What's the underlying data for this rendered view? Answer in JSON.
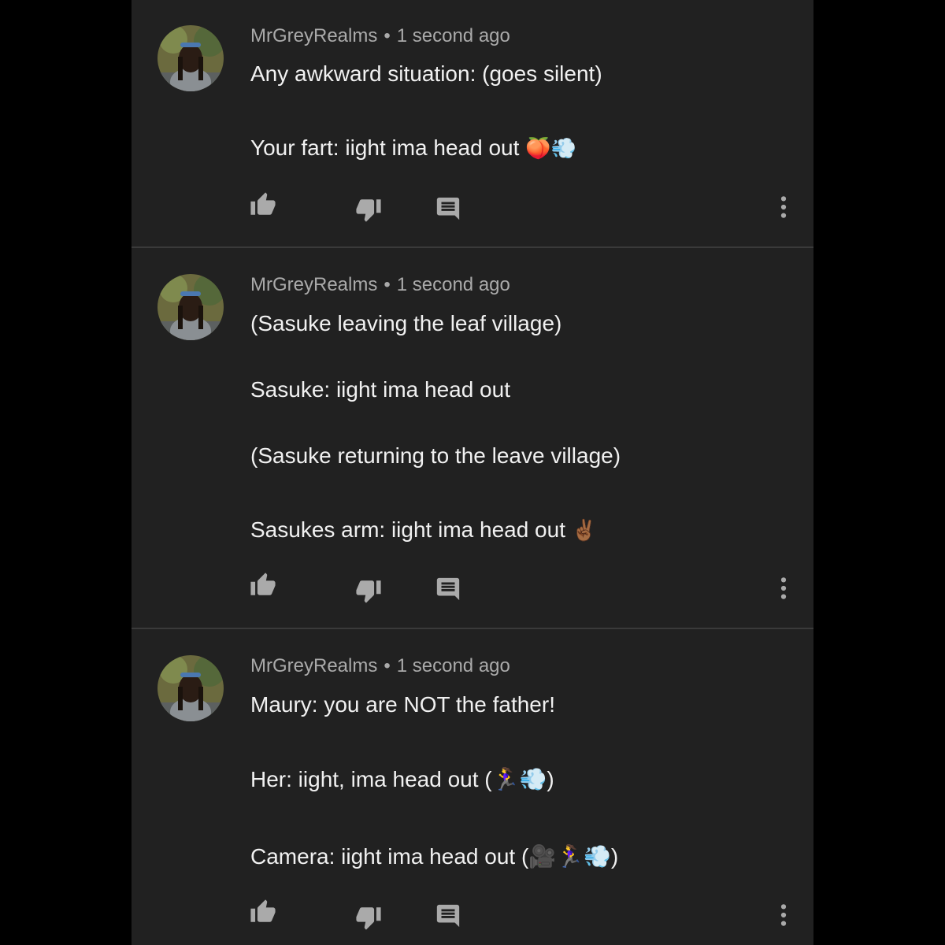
{
  "comments": [
    {
      "author": "MrGreyRealms",
      "separator": "•",
      "time": "1 second ago",
      "lines": [
        {
          "text": "Any awkward situation: (goes silent)",
          "emoji": ""
        },
        {
          "text": "Your fart: iight ima head out ",
          "emoji": "🍑💨"
        }
      ]
    },
    {
      "author": "MrGreyRealms",
      "separator": "•",
      "time": "1 second ago",
      "lines": [
        {
          "text": "(Sasuke leaving the leaf village)",
          "emoji": ""
        },
        {
          "text": "Sasuke: iight ima head out",
          "emoji": ""
        },
        {
          "text": "(Sasuke returning to the leave village)",
          "emoji": ""
        },
        {
          "text": "Sasukes arm: iight ima head out ",
          "emoji": "✌🏾"
        }
      ]
    },
    {
      "author": "MrGreyRealms",
      "separator": "•",
      "time": "1 second ago",
      "lines": [
        {
          "text": "Maury: you are NOT the father!",
          "emoji": ""
        },
        {
          "text": "Her: iight, ima head out (🏃‍♀️💨)",
          "emoji": ""
        },
        {
          "text": "Camera: iight ima head out (🎥🏃‍♀️💨)",
          "emoji": ""
        }
      ]
    }
  ],
  "icons": {
    "like": "thumbs-up-icon",
    "dislike": "thumbs-down-icon",
    "reply": "comment-icon",
    "more": "more-vert-icon"
  },
  "colors": {
    "background": "#212121",
    "text": "#f1f1f1",
    "meta": "#aaaaaa",
    "icon": "#aaaaaa"
  }
}
